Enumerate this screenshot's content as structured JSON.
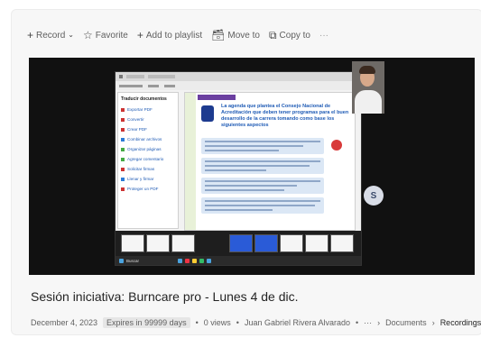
{
  "toolbar": {
    "record_label": "Record",
    "favorite_label": "Favorite",
    "add_to_playlist_label": "Add to playlist",
    "move_to_label": "Move to",
    "copy_to_label": "Copy to",
    "more_label": "···"
  },
  "video": {
    "participant_initial": "S",
    "shared_screen": {
      "doc_heading": "La agenda que plantea el Consejo Nacional de Acreditación que deben tener programas para el buen desarrollo de la carrera tomando como base los siguientes aspectos",
      "sidebar_title": "Traducir documentos",
      "sidebar_items": [
        "Exportar PDF",
        "Convertir",
        "Crear PDF",
        "Combinar archivos",
        "Organizar páginas",
        "Agregar comentario",
        "Solicitar firmas",
        "Llenar y firmar",
        "Proteger un PDF"
      ],
      "taskbar_search": "Buscar"
    }
  },
  "recording": {
    "title": "Sesión iniciativa: Burncare pro - Lunes 4 de dic.",
    "date": "December 4, 2023",
    "expires": "Expires in 99999 days",
    "views": "0 views",
    "owner": "Juan Gabriel Rivera Alvarado",
    "more": "···",
    "breadcrumb_documents": "Documents",
    "breadcrumb_recordings": "Recordings"
  }
}
